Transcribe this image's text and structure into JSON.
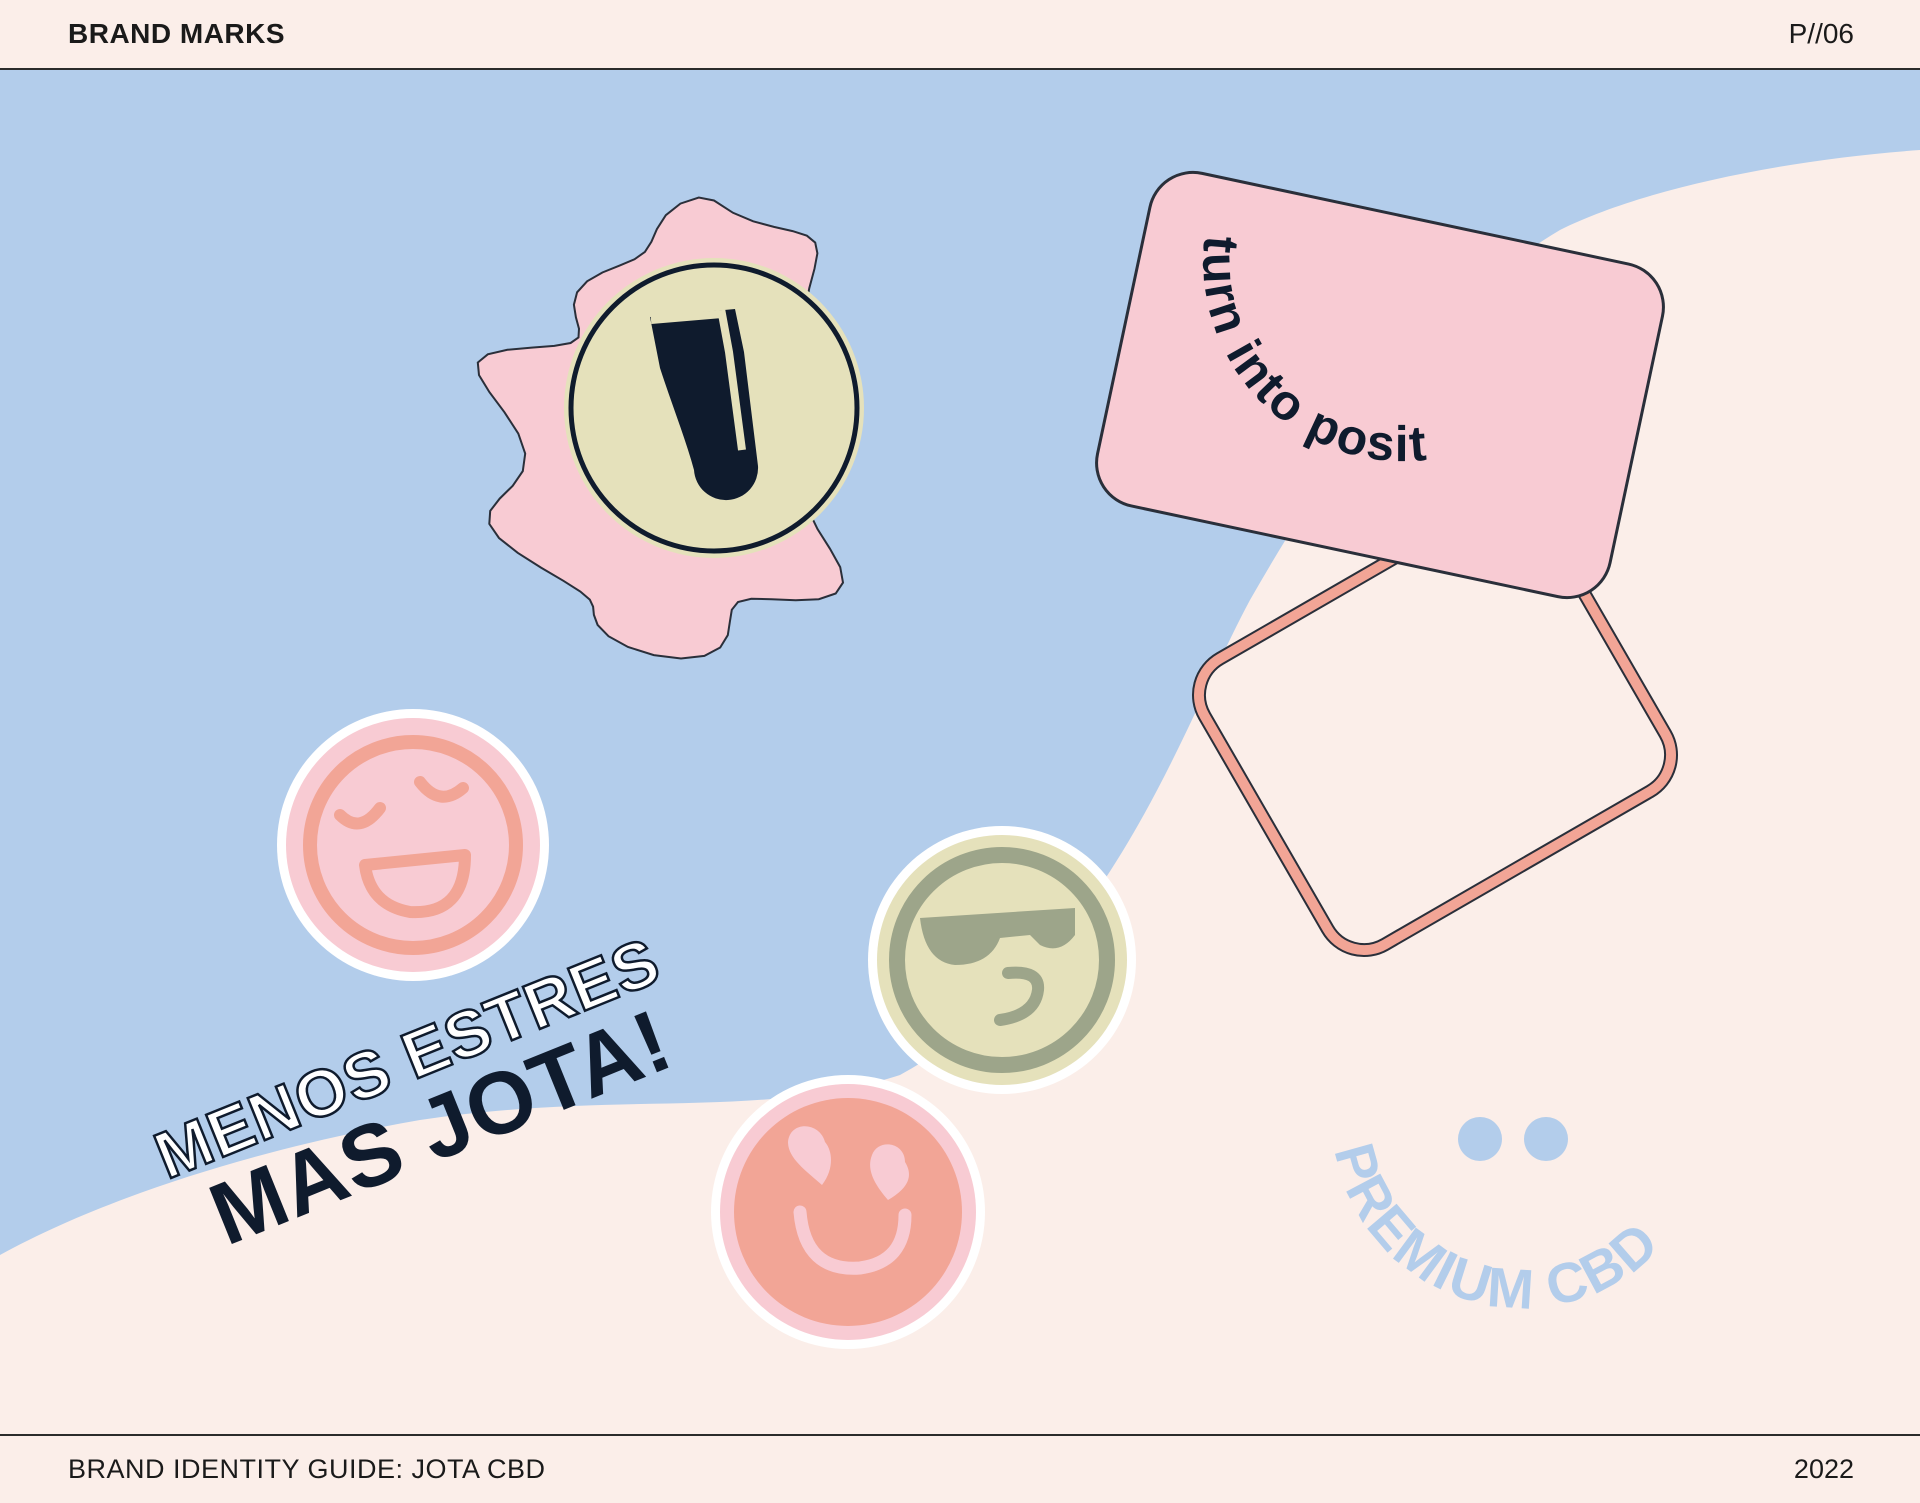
{
  "header": {
    "title": "BRAND MARKS",
    "page_number": "P//06"
  },
  "footer": {
    "guide": "BRAND IDENTITY GUIDE: JOTA CBD",
    "year": "2022"
  },
  "stickers": {
    "card_text": "turn into positive",
    "slogan_line1": "MENOS ESTRES",
    "slogan_line2": "MAS JOTA!",
    "premium_text": "PREMIUM CBD"
  },
  "colors": {
    "background": "#fbeee9",
    "blue": "#b3cdeb",
    "pink": "#f8cbd3",
    "salmon": "#f2a596",
    "sage_fill": "#e5e1bb",
    "sage_dark": "#9da58a",
    "navy": "#0f1b2d"
  },
  "icons": [
    "jota-logo-badge",
    "happy-face-sticker",
    "cool-face-sticker",
    "heart-eyes-sticker",
    "premium-smile-mark"
  ]
}
